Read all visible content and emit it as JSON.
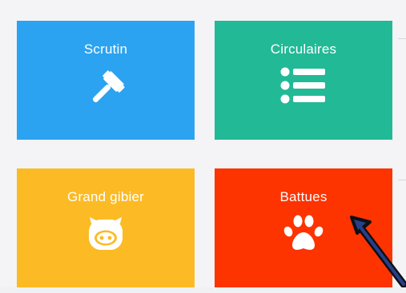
{
  "tiles": [
    {
      "label": "Scrutin",
      "icon": "gavel-icon",
      "color": "#2ba3f0"
    },
    {
      "label": "Circulaires",
      "icon": "list-icon",
      "color": "#22b996"
    },
    {
      "label": "Grand gibier",
      "icon": "boar-icon",
      "color": "#fcbb24"
    },
    {
      "label": "Battues",
      "icon": "paw-icon",
      "color": "#fd3300"
    }
  ],
  "icon_color": "#ffffff",
  "page_background": "#f4f4f6",
  "annotation": {
    "icon": "pointer-arrow-icon",
    "color": "#1a2a5c"
  }
}
